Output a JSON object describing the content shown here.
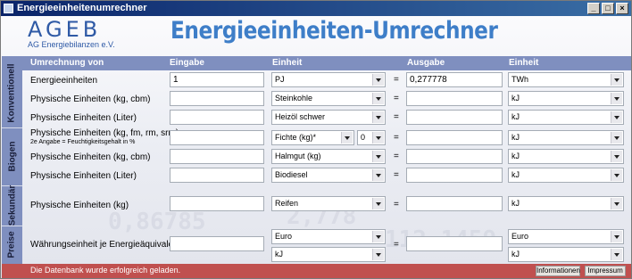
{
  "window": {
    "title": "Energieeinheitenumrechner"
  },
  "logo": {
    "text": "AGEB",
    "subtitle": "AG Energiebilanzen e.V."
  },
  "app_title": "Energieeinheiten-Umrechner",
  "header": {
    "col_from": "Umrechnung von",
    "col_input": "Eingabe",
    "col_unit": "Einheit",
    "col_output": "Ausgabe",
    "col_unit2": "Einheit"
  },
  "sections": [
    "Konventionell",
    "Biogen",
    "Sekundär",
    "Preise"
  ],
  "rows": [
    {
      "label": "Energieeinheiten",
      "input": "1",
      "unit": "PJ",
      "output": "0,277778",
      "out_unit": "TWh"
    },
    {
      "label": "Physische Einheiten (kg, cbm)",
      "input": "",
      "unit": "Steinkohle",
      "output": "",
      "out_unit": "kJ"
    },
    {
      "label": "Physische Einheiten (Liter)",
      "input": "",
      "unit": "Heizöl schwer",
      "output": "",
      "out_unit": "kJ"
    },
    {
      "label": "Physische Einheiten (kg, fm, rm, srm)",
      "sublabel": "2e Angabe = Feuchtigkeitsgehalt in %",
      "input": "",
      "unit": "Fichte (kg)*",
      "unit2": "0",
      "output": "",
      "out_unit": "kJ"
    },
    {
      "label": "Physische Einheiten (kg, cbm)",
      "input": "",
      "unit": "Halmgut (kg)",
      "output": "",
      "out_unit": "kJ"
    },
    {
      "label": "Physische Einheiten (Liter)",
      "input": "",
      "unit": "Biodiesel",
      "output": "",
      "out_unit": "kJ"
    },
    {
      "label": "Physische Einheiten (kg)",
      "input": "",
      "unit": "Reifen",
      "output": "",
      "out_unit": "kJ"
    },
    {
      "label": "Währungseinheit je Energieäquivalent",
      "input": "",
      "unit": "Euro",
      "unit_b": "kJ",
      "output": "",
      "out_unit": "Euro",
      "out_unit_b": "kJ"
    }
  ],
  "equals": "=",
  "status": {
    "text": "Die Datenbank wurde erfolgreich geladen.",
    "btn_info": "Informationen",
    "btn_impressum": "Impressum"
  },
  "win_buttons": {
    "min": "_",
    "max": "□",
    "close": "×"
  },
  "decor": {
    "n1": "2,778 ",
    "n2": "0,86785",
    "n3": "112,1459"
  },
  "colors": {
    "header_bg": "#7f8fbf",
    "status_bg": "#c0504f",
    "title_blue": "#3e7ec8",
    "logo_blue": "#2f5aa6"
  }
}
